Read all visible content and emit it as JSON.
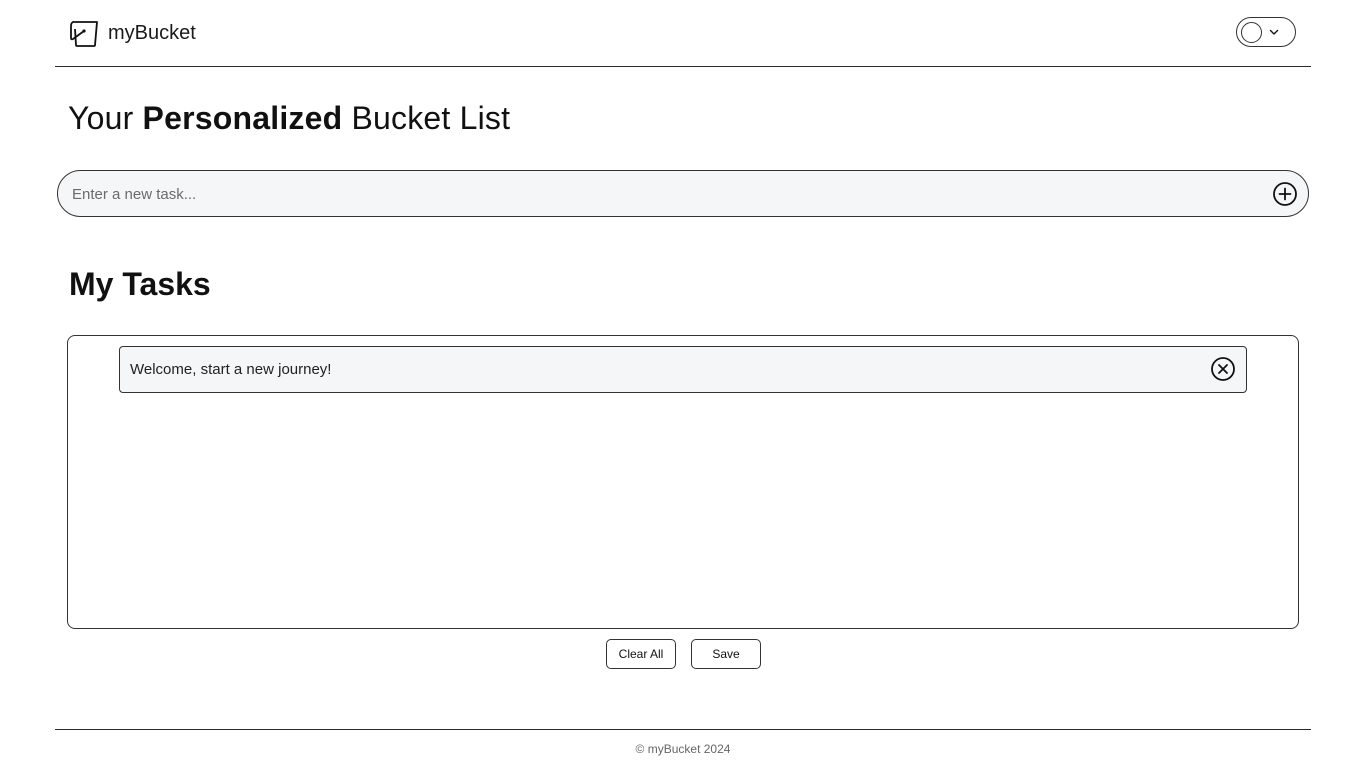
{
  "header": {
    "brand_name": "myBucket",
    "logo_icon": "bucket-icon",
    "theme_toggle": {
      "icon": "circle-icon",
      "dropdown_icon": "chevron-down-icon"
    }
  },
  "hero": {
    "title_prefix": "Your ",
    "title_bold": "Personalized",
    "title_suffix": " Bucket List"
  },
  "task_input": {
    "placeholder": "Enter a new task...",
    "value": "",
    "add_icon": "plus-circle-icon"
  },
  "tasks": {
    "heading": "My Tasks",
    "items": [
      {
        "text": "Welcome, start a new journey!",
        "remove_icon": "x-circle-icon"
      }
    ]
  },
  "actions": {
    "clear_label": "Clear All",
    "save_label": "Save"
  },
  "footer": {
    "text": "© myBucket 2024"
  }
}
